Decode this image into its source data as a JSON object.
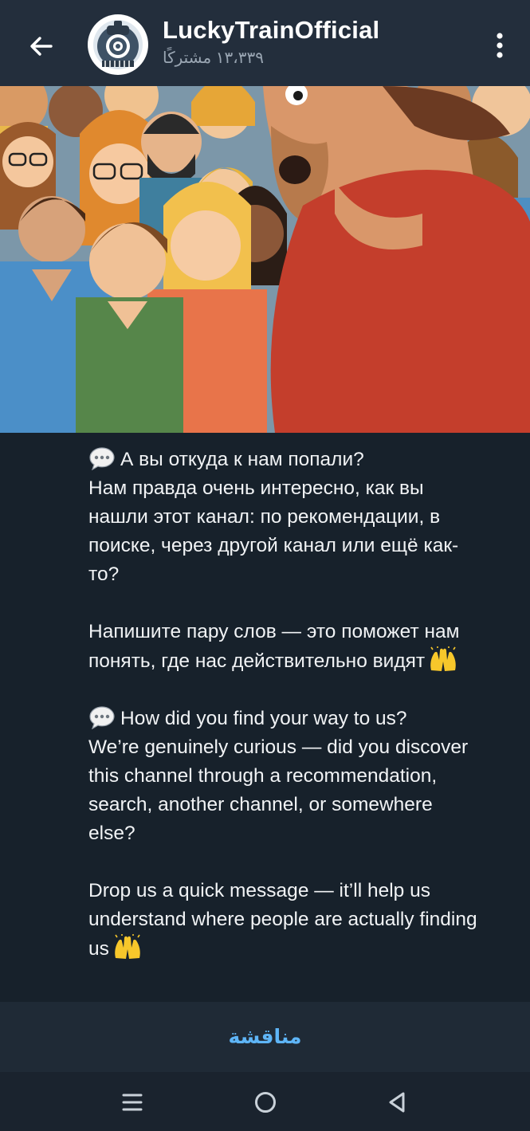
{
  "header": {
    "channel_name": "LuckyTrainOfficial",
    "subscribers": "۱۳،۳۳۹ مشترکًا"
  },
  "message": {
    "ru_line1": "А вы откуда к нам попали?",
    "ru_line2": "Нам правда очень интересно, как вы нашли этот канал: по рекомендации, в поиске, через другой канал или ещё как-то?",
    "ru_line3": "Напишите пару слов — это поможет нам понять, где нас действительно видят",
    "en_line1": "How did you find your way to us?",
    "en_line2": "We’re genuinely curious — did you discover this channel through a recommendation, search, another channel, or somewhere else?",
    "en_line3": "Drop us a quick message — it’ll help us understand where people are actually finding us"
  },
  "discuss": {
    "label": "مناقشة"
  },
  "icons": {
    "back": "arrow-left-icon",
    "menu": "more-vertical-icon",
    "speech": "speech-balloon-icon",
    "hands": "raising-hands-icon",
    "nav_recent": "recent-apps-icon",
    "nav_home": "home-circle-icon",
    "nav_back": "back-triangle-icon"
  },
  "colors": {
    "background": "#17212b",
    "header": "#232e3c",
    "accent": "#5eb5f7"
  }
}
